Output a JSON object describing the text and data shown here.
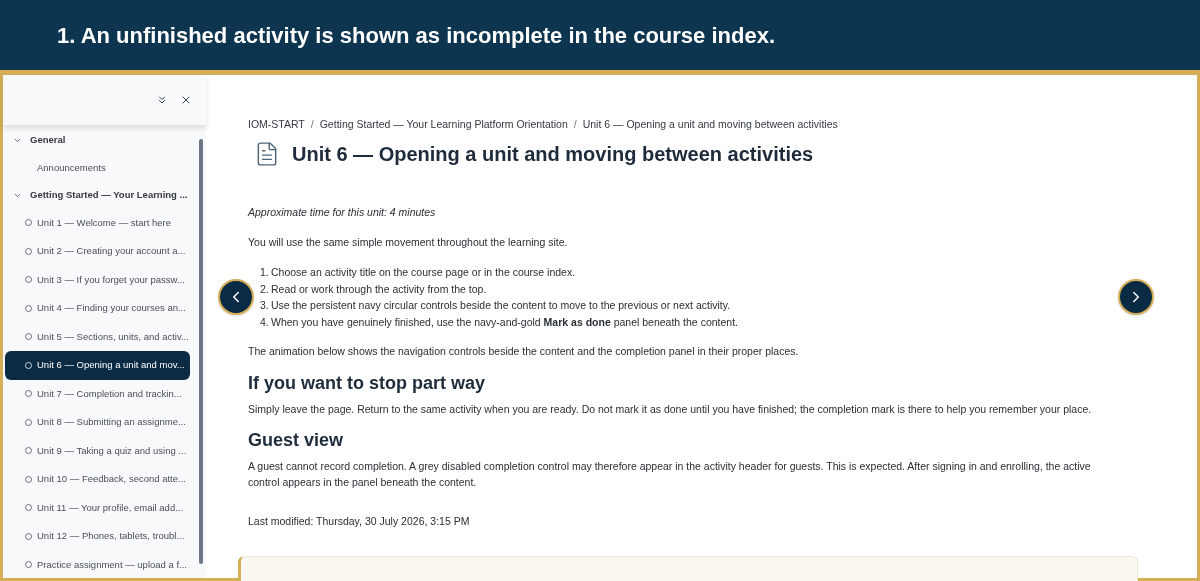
{
  "banner": {
    "title": "1. An unfinished activity is shown as incomplete in the course index."
  },
  "course_index": {
    "sections": [
      {
        "title": "General",
        "expanded": true,
        "items": [
          {
            "label": "Announcements",
            "kind": "plain",
            "selected": false
          }
        ]
      },
      {
        "title": "Getting Started — Your Learning ...",
        "expanded": true,
        "items": [
          {
            "label": "Unit 1 — Welcome — start here",
            "kind": "activity",
            "selected": false
          },
          {
            "label": "Unit 2 — Creating your account a...",
            "kind": "activity",
            "selected": false
          },
          {
            "label": "Unit 3 — If you forget your passw...",
            "kind": "activity",
            "selected": false
          },
          {
            "label": "Unit 4 — Finding your courses an...",
            "kind": "activity",
            "selected": false
          },
          {
            "label": "Unit 5 — Sections, units, and activ...",
            "kind": "activity",
            "selected": false
          },
          {
            "label": "Unit 6 — Opening a unit and mov...",
            "kind": "activity",
            "selected": true
          },
          {
            "label": "Unit 7 — Completion and trackin...",
            "kind": "activity",
            "selected": false
          },
          {
            "label": "Unit 8 — Submitting an assignme...",
            "kind": "activity",
            "selected": false
          },
          {
            "label": "Unit 9 — Taking a quiz and using ...",
            "kind": "activity",
            "selected": false
          },
          {
            "label": "Unit 10 — Feedback, second atte...",
            "kind": "activity",
            "selected": false
          },
          {
            "label": "Unit 11 — Your profile, email add...",
            "kind": "activity",
            "selected": false
          },
          {
            "label": "Unit 12 — Phones, tablets, troubl...",
            "kind": "activity",
            "selected": false
          },
          {
            "label": "Practice assignment — upload a f...",
            "kind": "activity",
            "selected": false
          }
        ]
      }
    ]
  },
  "breadcrumb": [
    {
      "label": "IOM-START"
    },
    {
      "separator": "/",
      "label": "Getting Started — Your Learning Platform Orientation"
    },
    {
      "separator": "/",
      "label": "Unit 6 — Opening a unit and moving between activities"
    }
  ],
  "page": {
    "title": "Unit 6 — Opening a unit and moving between activities",
    "time_note": "Approximate time for this unit: 4 minutes",
    "intro": "You will use the same simple movement throughout the learning site.",
    "steps": [
      {
        "number": "1.",
        "text": "Choose an activity title on the course page or in the course index."
      },
      {
        "number": "2.",
        "text": "Read or work through the activity from the top."
      },
      {
        "number": "3.",
        "text": "Use the persistent navy circular controls beside the content to move to the previous or next activity."
      },
      {
        "number": "4.",
        "text": "When you have genuinely finished, use the navy-and-gold **Mark as done** panel beneath the content."
      }
    ],
    "animation_note": "The animation below shows the navigation controls beside the content and the completion panel in their proper places.",
    "sections": [
      {
        "heading": "If you want to stop part way",
        "text": "Simply leave the page. Return to the same activity when you are ready. Do not mark it as done until you have finished; the completion mark is there to help you remember your place."
      },
      {
        "heading": "Guest view",
        "text": "A guest cannot record completion. A grey disabled completion control may therefore appear in the activity header for guests. This is expected. After signing in and enrolling, the active control appears in the panel beneath the content."
      }
    ],
    "last_modified": "Last modified: Thursday, 30 July 2026, 3:15 PM"
  }
}
